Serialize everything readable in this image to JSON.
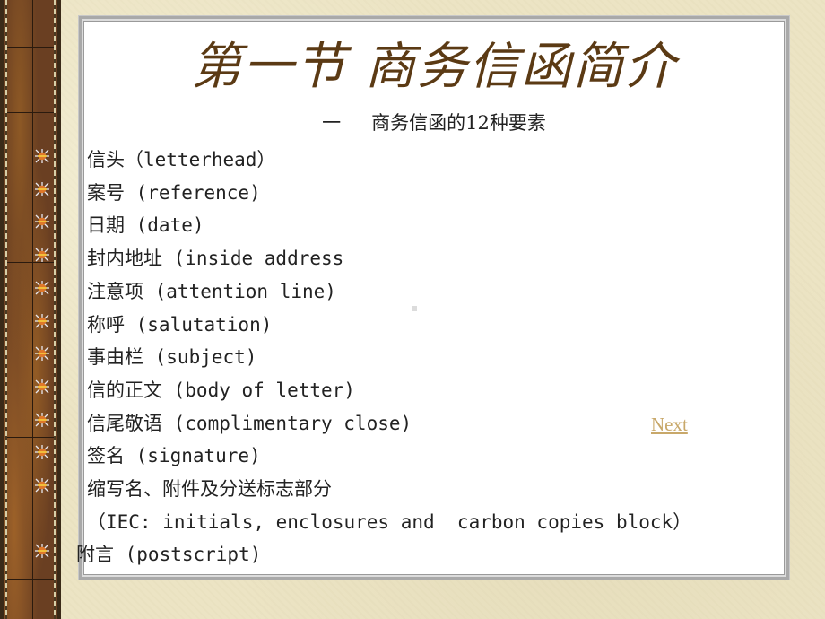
{
  "slide": {
    "title": "第一节  商务信函简介",
    "subtitle_prefix": "一",
    "subtitle": "商务信函的12种要素",
    "items": [
      {
        "text": "信头（letterhead）",
        "bullet": true
      },
      {
        "text": "案号 (reference)",
        "bullet": true
      },
      {
        "text": "日期 (date)",
        "bullet": true
      },
      {
        "text": "封内地址 (inside address",
        "bullet": true
      },
      {
        "text": "注意项 (attention line)",
        "bullet": true
      },
      {
        "text": "称呼 (salutation)",
        "bullet": true
      },
      {
        "text": "事由栏 (subject)",
        "bullet": true
      },
      {
        "text": "信的正文 (body of letter)",
        "bullet": true
      },
      {
        "text": "信尾敬语 (complimentary close)",
        "bullet": true
      },
      {
        "text": "签名 (signature)",
        "bullet": true
      },
      {
        "text": "缩写名、附件及分送标志部分",
        "bullet": true
      },
      {
        "text": "（IEC: initials, enclosures and  carbon copies block）",
        "bullet": false
      },
      {
        "text": "附言 (postscript)",
        "bullet": true
      }
    ],
    "next_link": "Next"
  },
  "colors": {
    "title": "#5b3a14",
    "link": "#c8a86a",
    "background": "#ece4c4",
    "strip": "#6a3f22"
  },
  "icons": {
    "bullet": "starburst-bullet-icon"
  }
}
